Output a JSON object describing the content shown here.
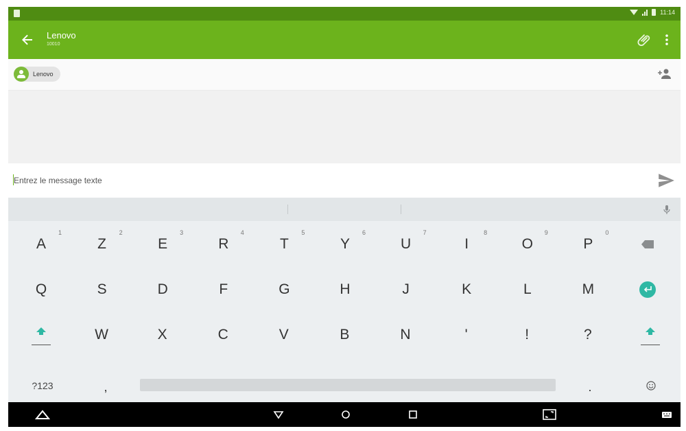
{
  "status_bar": {
    "time": "11:14"
  },
  "app_bar": {
    "title": "Lenovo",
    "subtitle": "10010"
  },
  "recipient": {
    "name": "Lenovo"
  },
  "compose": {
    "placeholder": "Entrez le message texte"
  },
  "keyboard": {
    "row1": [
      {
        "key": "A",
        "hint": "1"
      },
      {
        "key": "Z",
        "hint": "2"
      },
      {
        "key": "E",
        "hint": "3"
      },
      {
        "key": "R",
        "hint": "4"
      },
      {
        "key": "T",
        "hint": "5"
      },
      {
        "key": "Y",
        "hint": "6"
      },
      {
        "key": "U",
        "hint": "7"
      },
      {
        "key": "I",
        "hint": "8"
      },
      {
        "key": "O",
        "hint": "9"
      },
      {
        "key": "P",
        "hint": "0"
      }
    ],
    "row2": [
      "Q",
      "S",
      "D",
      "F",
      "G",
      "H",
      "J",
      "K",
      "L",
      "M"
    ],
    "row3": [
      "W",
      "X",
      "C",
      "V",
      "B",
      "N",
      "'",
      "!",
      "?"
    ],
    "row4": {
      "symbols": "?123",
      "comma": ",",
      "period": "."
    }
  },
  "colors": {
    "app_bar": "#6cb31c",
    "status_bar": "#4f8c12",
    "accent": "#2fb8a4",
    "nav_bar": "#000000"
  },
  "icons": {
    "back": "arrow-left-icon",
    "attach": "paperclip-icon",
    "more": "more-vert-icon",
    "add_contact": "person-add-icon",
    "send": "send-icon",
    "mic": "mic-icon",
    "backspace": "backspace-icon",
    "enter": "enter-icon",
    "shift": "shift-icon",
    "emoji": "emoji-icon"
  }
}
